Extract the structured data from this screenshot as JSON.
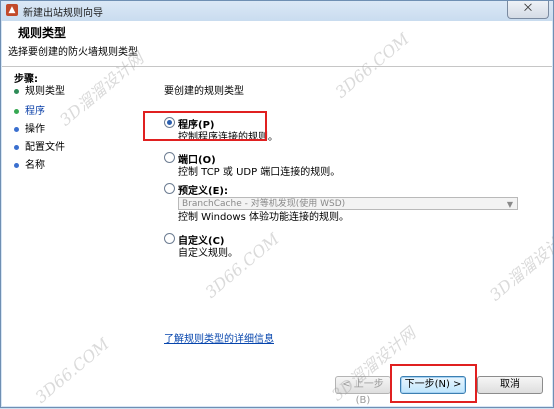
{
  "window": {
    "title": "新建出站规则向导",
    "close_label": "⨉"
  },
  "header": {
    "title": "规则类型",
    "subtitle": "选择要创建的防火墙规则类型"
  },
  "steps": {
    "title": "步骤:",
    "items": [
      {
        "label": "规则类型",
        "state": "done"
      },
      {
        "label": "程序",
        "state": "current"
      },
      {
        "label": "操作",
        "state": "pending"
      },
      {
        "label": "配置文件",
        "state": "pending"
      },
      {
        "label": "名称",
        "state": "pending"
      }
    ]
  },
  "content": {
    "prompt": "要创建的规则类型",
    "options": [
      {
        "title": "程序(P)",
        "desc": "控制程序连接的规则。",
        "checked": true
      },
      {
        "title": "端口(O)",
        "desc": "控制 TCP 或 UDP 端口连接的规则。",
        "checked": false
      },
      {
        "title": "预定义(E):",
        "desc": "控制 Windows 体验功能连接的规则。",
        "checked": false
      },
      {
        "title": "自定义(C)",
        "desc": "自定义规则。",
        "checked": false
      }
    ],
    "predefined_select": "BranchCache - 对等机发现(使用 WSD)",
    "link": "了解规则类型的详细信息"
  },
  "buttons": {
    "back": "< 上一步(B)",
    "next": "下一步(N) >",
    "cancel": "取消"
  },
  "watermarks": {
    "site": "3D66.COM",
    "brand": "3D溜溜设计网"
  },
  "colors": {
    "highlight": "#e02020",
    "link": "#0645ad"
  }
}
